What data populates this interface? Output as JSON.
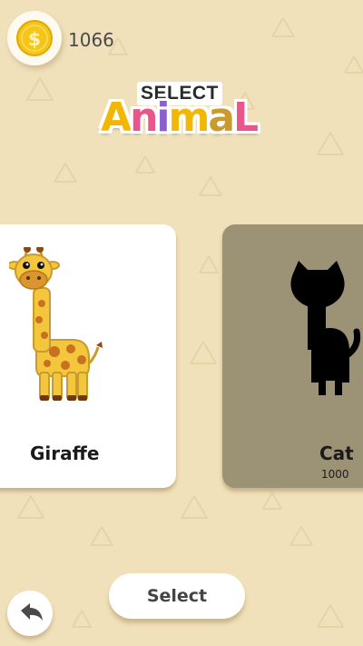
{
  "header": {
    "coin_icon": "coin-dollar-icon",
    "coin_count": "1066",
    "title_line1": "SELECT",
    "title_line2": "AnimaL"
  },
  "animals": [
    {
      "name": "Giraffe",
      "price": "",
      "locked": false,
      "icon": "giraffe-image"
    },
    {
      "name": "Cat",
      "price": "1000",
      "locked": true,
      "icon": "cat-silhouette-image"
    }
  ],
  "buttons": {
    "select_label": "Select",
    "back_icon": "back-arrow-icon"
  },
  "colors": {
    "background": "#f1e1bb",
    "card_unlocked": "#ffffff",
    "card_locked": "#9c9377",
    "coin": "#f5c518"
  }
}
